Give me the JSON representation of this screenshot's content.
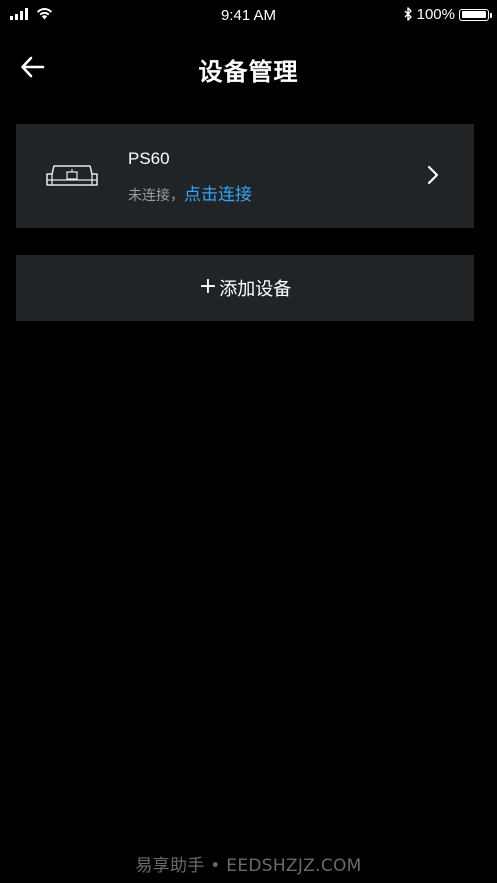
{
  "status_bar": {
    "time": "9:41 AM",
    "battery_text": "100%",
    "battery_level": 1.0
  },
  "nav": {
    "title": "设备管理"
  },
  "device": {
    "name": "PS60",
    "status_prefix": "未连接，",
    "connect_label": "点击连接"
  },
  "add_device": {
    "plus": "+",
    "label": "添加设备"
  },
  "watermark": {
    "text": "易享助手 • EEDSHZJZ.COM"
  },
  "colors": {
    "background": "#000000",
    "card": "#212426",
    "link": "#35a3f4",
    "muted_text": "#9a9ea2"
  }
}
